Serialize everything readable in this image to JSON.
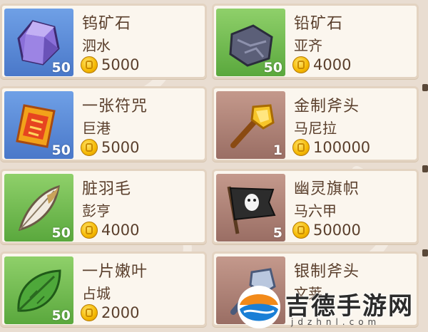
{
  "items": [
    {
      "name": "钨矿石",
      "location": "泗水",
      "price": "5000",
      "qty": "50",
      "bg": "blue",
      "icon": "purple-gem-icon"
    },
    {
      "name": "铅矿石",
      "location": "亚齐",
      "price": "4000",
      "qty": "50",
      "bg": "green",
      "icon": "gray-ore-icon"
    },
    {
      "name": "一张符咒",
      "location": "巨港",
      "price": "5000",
      "qty": "50",
      "bg": "blue",
      "icon": "talisman-icon"
    },
    {
      "name": "金制斧头",
      "location": "马尼拉",
      "price": "100000",
      "qty": "1",
      "bg": "brown",
      "icon": "golden-axe-icon"
    },
    {
      "name": "脏羽毛",
      "location": "彭亨",
      "price": "4000",
      "qty": "50",
      "bg": "green",
      "icon": "feather-icon"
    },
    {
      "name": "幽灵旗帜",
      "location": "马六甲",
      "price": "50000",
      "qty": "5",
      "bg": "brown",
      "icon": "ghost-flag-icon"
    },
    {
      "name": "一片嫩叶",
      "location": "占城",
      "price": "2000",
      "qty": "50",
      "bg": "green",
      "icon": "leaf-icon"
    },
    {
      "name": "银制斧头",
      "location": "文莱",
      "price": "",
      "qty": "",
      "bg": "brown",
      "icon": "silver-axe-icon"
    }
  ],
  "watermark": {
    "title": "吉德手游网",
    "url": "jdzhnl.com"
  },
  "colors": {
    "text": "#5a3f2c",
    "card": "#fbf6ee",
    "blue": "#4a78c9",
    "green": "#5aa83d",
    "brown": "#9a6e64"
  }
}
